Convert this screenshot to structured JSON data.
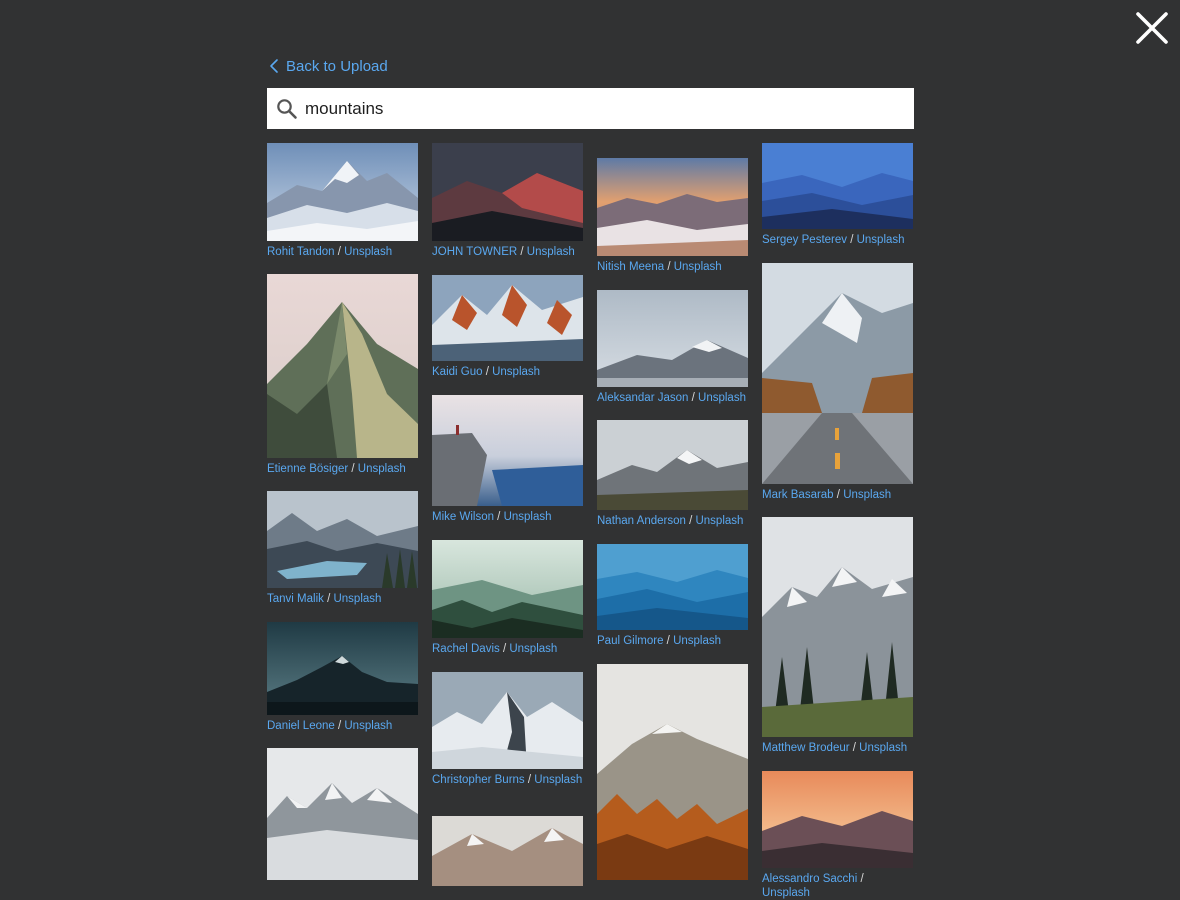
{
  "header": {
    "back_label": "Back to Upload",
    "search_value": "mountains"
  },
  "results": [
    {
      "photographer": "Rohit Tandon",
      "source": "Unsplash"
    },
    {
      "photographer": "Etienne Bösiger",
      "source": "Unsplash"
    },
    {
      "photographer": "Tanvi Malik",
      "source": "Unsplash"
    },
    {
      "photographer": "Daniel Leone",
      "source": "Unsplash"
    },
    {
      "photographer": "",
      "source": ""
    },
    {
      "photographer": "JOHN TOWNER",
      "source": "Unsplash"
    },
    {
      "photographer": "Kaidi Guo",
      "source": "Unsplash"
    },
    {
      "photographer": "Mike Wilson",
      "source": "Unsplash"
    },
    {
      "photographer": "Rachel Davis",
      "source": "Unsplash"
    },
    {
      "photographer": "Christopher Burns",
      "source": "Unsplash"
    },
    {
      "photographer": "",
      "source": ""
    },
    {
      "photographer": "Nitish Meena",
      "source": "Unsplash"
    },
    {
      "photographer": "Aleksandar Jason",
      "source": "Unsplash"
    },
    {
      "photographer": "Nathan Anderson",
      "source": "Unsplash"
    },
    {
      "photographer": "Paul Gilmore",
      "source": "Unsplash"
    },
    {
      "photographer": "",
      "source": ""
    },
    {
      "photographer": "Sergey Pesterev",
      "source": "Unsplash"
    },
    {
      "photographer": "Mark Basarab",
      "source": "Unsplash"
    },
    {
      "photographer": "Matthew Brodeur",
      "source": "Unsplash"
    },
    {
      "photographer": "Alessandro Sacchi",
      "source": "Unsplash"
    }
  ]
}
